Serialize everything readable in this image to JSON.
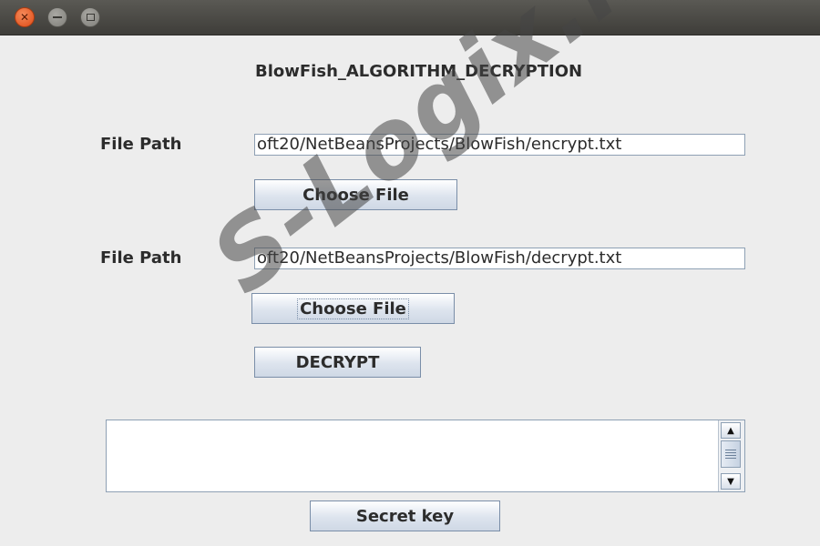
{
  "window": {
    "controls": {
      "close_icon": "close-icon",
      "minimize_icon": "minimize-icon",
      "maximize_icon": "maximize-icon"
    }
  },
  "form": {
    "title": "BlowFish_ALGORITHM_DECRYPTION",
    "input_file": {
      "label": "File Path",
      "value": "oft20/NetBeansProjects/BlowFish/encrypt.txt",
      "button": "Choose File"
    },
    "output_file": {
      "label": "File Path",
      "value": "oft20/NetBeansProjects/BlowFish/decrypt.txt",
      "button": "Choose File"
    },
    "decrypt_button": "DECRYPT",
    "result_text": "",
    "secret_key_button": "Secret key"
  },
  "watermark": "S-Logix.in",
  "colors": {
    "window_bg": "#ededed",
    "titlebar": "#3e3d39",
    "close_button": "#df4b16",
    "button_border": "#7a8ea8",
    "field_border": "#8ea0b4"
  }
}
